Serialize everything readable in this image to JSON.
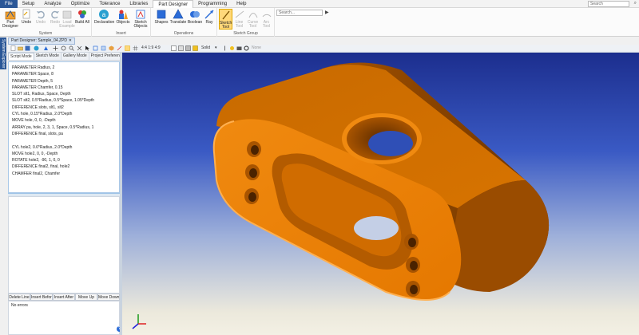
{
  "menu": [
    "File",
    "Setup",
    "Analyze",
    "Optimize",
    "Tolerance",
    "Libraries",
    "Part Designer",
    "Programming",
    "Help"
  ],
  "menu_active": "Part Designer",
  "top_search_placeholder": "Search",
  "ribbon": {
    "groups": [
      {
        "label": "System",
        "buttons": [
          "Part Designer",
          "Undo",
          "Undo",
          "Redo",
          "Load Example",
          "Build All"
        ]
      },
      {
        "label": "Insert",
        "buttons": [
          "Declaration",
          "Objects",
          "Sketch Objects"
        ]
      },
      {
        "label": "Operations",
        "buttons": [
          "Shapes",
          "Translate",
          "Boolean",
          "Ray"
        ]
      },
      {
        "label": "Sketch Group",
        "buttons": [
          "Sketch Tool",
          "Line Tool",
          "Curve Tool",
          "Arc Tool"
        ]
      }
    ],
    "search_placeholder": "Search...",
    "search_go": "▶"
  },
  "side_tab": "System Explorer",
  "doc_tab": {
    "label": "Part Designer: Sample_04.ZPD",
    "close": "✕"
  },
  "toolbar2": {
    "zoom_labels": "4:4  1:9  4:9",
    "render_mode": "Solid",
    "view_select": "None"
  },
  "panel_tabs": [
    "Script Mode",
    "Sketch Mode",
    "Gallery Mode",
    "Project Preferences"
  ],
  "script_lines": [
    "PARAMETER Radius, 2",
    "PARAMETER Space, 8",
    "PARAMETER Depth, 5",
    "PARAMETER Chamfer, 0.15",
    "SLOT slt1, Radius, Space, Depth",
    "SLOT slt2, 0.5*Radius, 0.5*Space, 1.05*Depth",
    "DIFFERENCE slots, slt1, slt2",
    "CYL hole, 0.15*Radius, 2.0*Depth",
    "MOVE hole, 0, 0, -Depth",
    "ARRAY pa, hole, 2, 3, 1, Space, 0.5*Radius, 1",
    "DIFFERENCE final, slots, pa",
    "",
    "CYL hole2, 0.6*Radius, 2.0*Depth",
    "MOVE hole2, 0, 0, -Depth",
    "ROTATE hole2, -90, 1, 0, 0",
    "DIFFERENCE final2, final, hole2",
    "CHAMFER final2, Chamfer"
  ],
  "line_buttons": [
    "Delete Line",
    "Insert Before",
    "Insert After",
    "Move Up",
    "Move Down"
  ],
  "errors_text": "No errors",
  "help_symbol": "?",
  "colors": {
    "part_orange": "#e97b00",
    "part_shadow": "#a24e00",
    "part_highlight": "#ffa842",
    "viewport_top": "#1c2e8e",
    "viewport_bottom": "#f3f0e4",
    "accent": "#2b5797"
  }
}
